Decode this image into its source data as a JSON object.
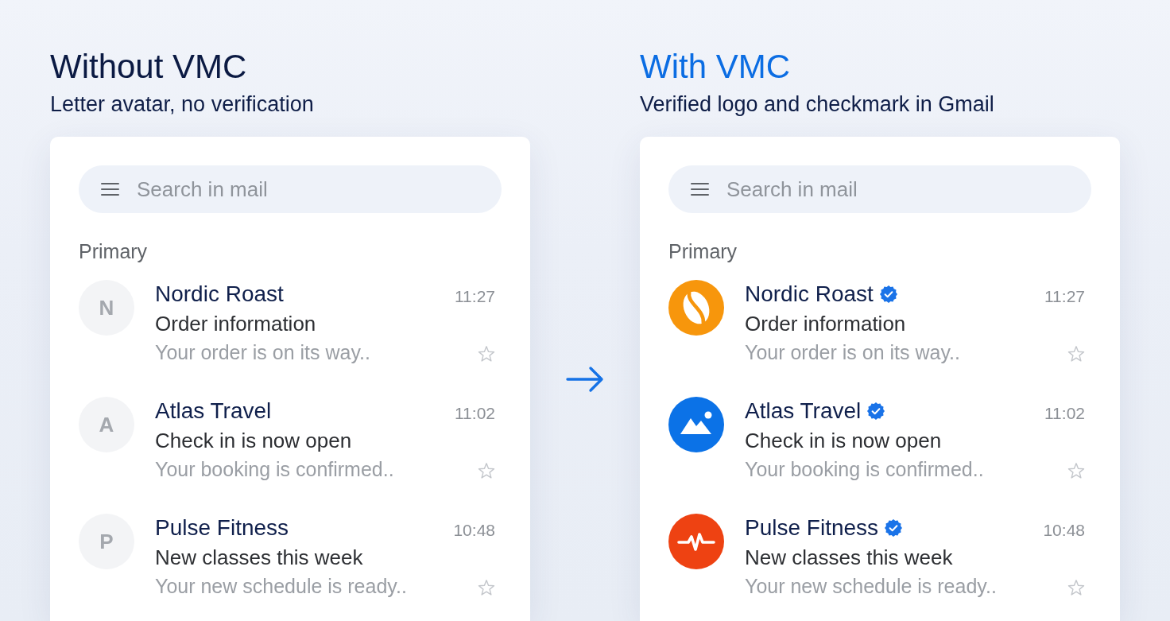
{
  "panels": [
    {
      "title": "Without VMC",
      "color": "#0b1a43",
      "subtitle": "Letter avatar, no verification",
      "search": {
        "placeholder": "Search in mail"
      },
      "section": "Primary",
      "emails": [
        {
          "avatar": {
            "kind": "letter",
            "letter": "N"
          },
          "sender": "Nordic Roast",
          "verified": false,
          "time": "11:27",
          "subject": "Order information",
          "preview": "Your order is on its way..",
          "starred": false
        },
        {
          "avatar": {
            "kind": "letter",
            "letter": "A"
          },
          "sender": "Atlas Travel",
          "verified": false,
          "time": "11:02",
          "subject": "Check in is now open",
          "preview": "Your booking is confirmed..",
          "starred": false
        },
        {
          "avatar": {
            "kind": "letter",
            "letter": "P"
          },
          "sender": "Pulse Fitness",
          "verified": false,
          "time": "10:48",
          "subject": "New classes this week",
          "preview": "Your new schedule is ready..",
          "starred": false
        }
      ]
    },
    {
      "title": "With VMC",
      "color": "#0b6de3",
      "subtitle": "Verified logo and checkmark in Gmail",
      "search": {
        "placeholder": "Search in mail"
      },
      "section": "Primary",
      "emails": [
        {
          "avatar": {
            "kind": "logo",
            "color": "#f7960c"
          },
          "sender": "Nordic Roast",
          "verified": true,
          "time": "11:27",
          "subject": "Order information",
          "preview": "Your order is on its way..",
          "starred": false
        },
        {
          "avatar": {
            "kind": "logo",
            "color": "#0b72e7"
          },
          "sender": "Atlas Travel",
          "verified": true,
          "time": "11:02",
          "subject": "Check in is now open",
          "preview": "Your booking is confirmed..",
          "starred": false
        },
        {
          "avatar": {
            "kind": "logo",
            "color": "#ee4212"
          },
          "sender": "Pulse Fitness",
          "verified": true,
          "time": "10:48",
          "subject": "New classes this week",
          "preview": "Your new schedule is ready..",
          "starred": false
        }
      ]
    }
  ]
}
